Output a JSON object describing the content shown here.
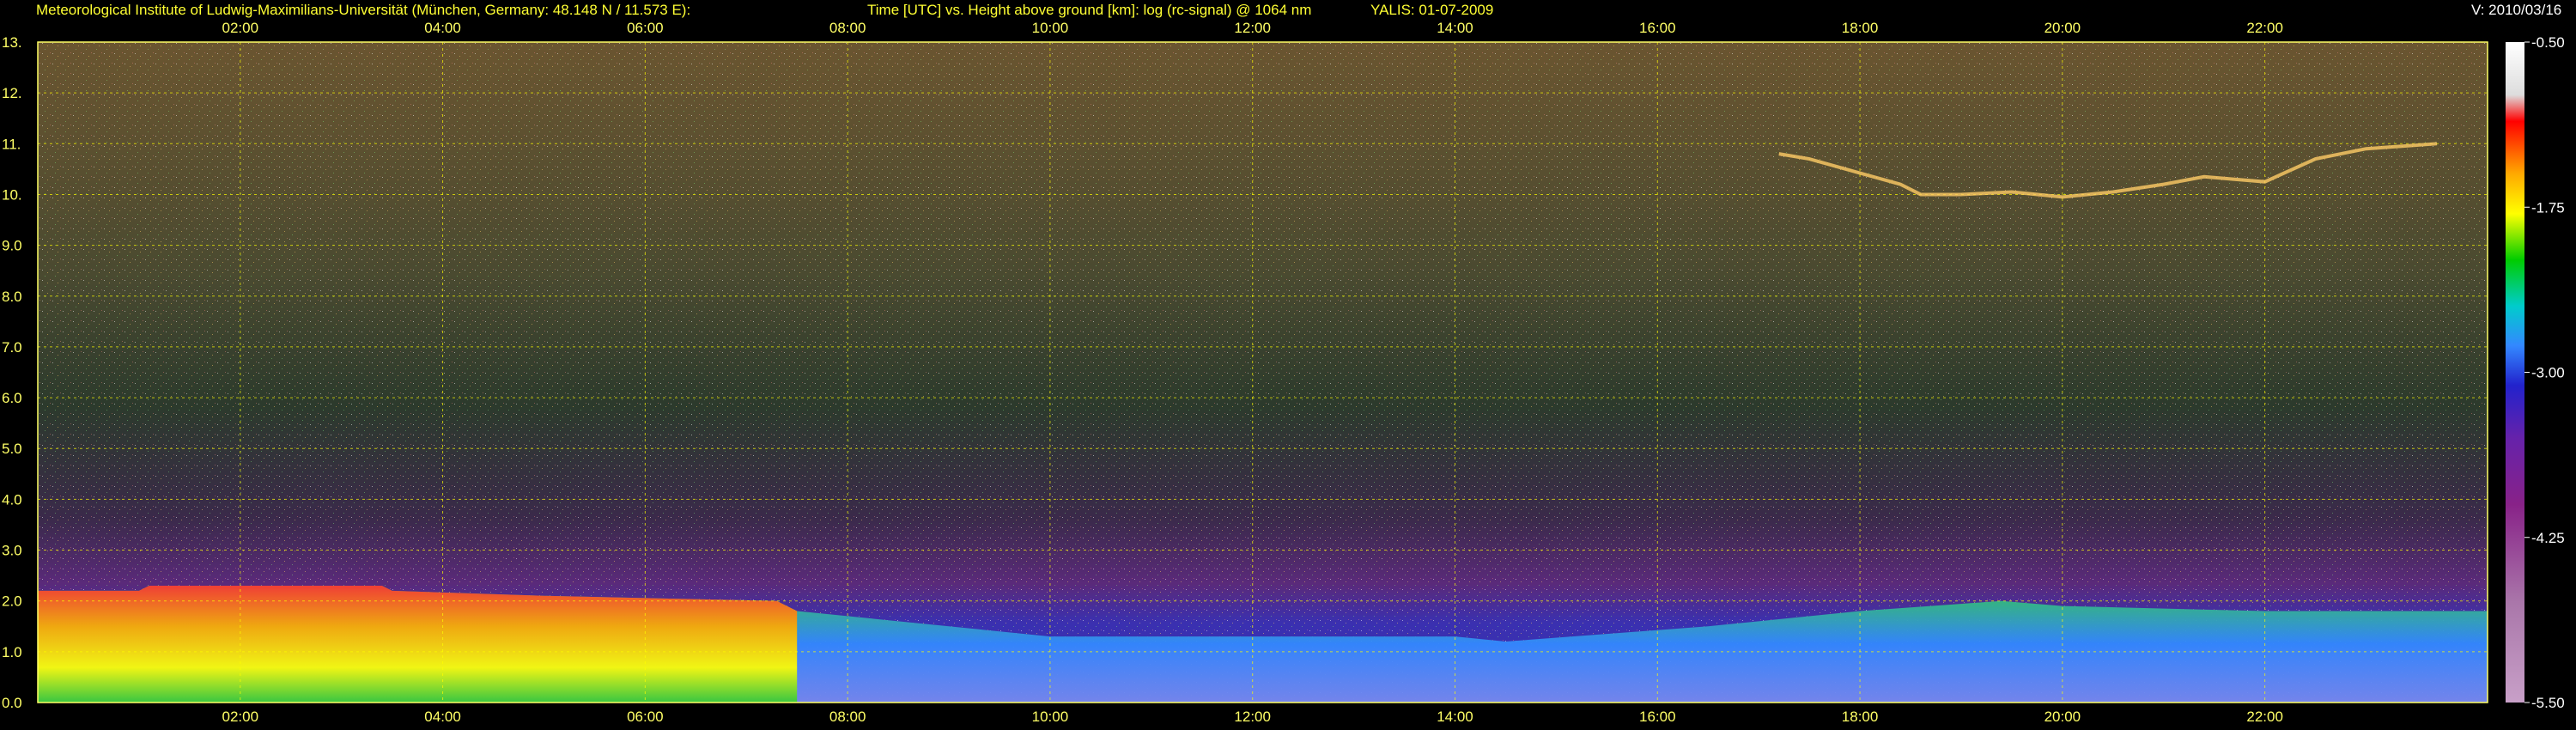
{
  "header": {
    "institute": "Meteorological Institute of Ludwig-Maximilians-Universität (München, Germany: 48.148 N / 11.573 E):",
    "plot_title": "Time [UTC] vs. Height above ground [km]: log (rc-signal) @ 1064 nm",
    "instrument": "YALIS: 01-07-2009",
    "version": "V: 2010/03/16"
  },
  "colors": {
    "header_text": "#ffff33",
    "tick_text": "#ffff66",
    "grid": "#ffff00",
    "background": "#000000"
  },
  "chart_data": {
    "type": "heatmap",
    "title": "Time [UTC] vs. Height above ground [km]: log (rc-signal) @ 1064 nm",
    "xlabel": "",
    "ylabel": "",
    "x_ticks": [
      "02:00",
      "04:00",
      "06:00",
      "08:00",
      "10:00",
      "12:00",
      "14:00",
      "16:00",
      "18:00",
      "20:00",
      "22:00"
    ],
    "x_tick_hours": [
      2,
      4,
      6,
      8,
      10,
      12,
      14,
      16,
      18,
      20,
      22
    ],
    "xlim_hours": [
      0.0,
      24.2
    ],
    "y_ticks": [
      "0.0",
      "1.0",
      "2.0",
      "3.0",
      "4.0",
      "5.0",
      "6.0",
      "7.0",
      "8.0",
      "9.0",
      "10.",
      "11.",
      "12.",
      "13."
    ],
    "y_tick_values": [
      0,
      1,
      2,
      3,
      4,
      5,
      6,
      7,
      8,
      9,
      10,
      11,
      12,
      13
    ],
    "ylim_km": [
      0,
      13
    ],
    "grid": true,
    "colorbar": {
      "ticks": [
        "-0.50",
        "-1.75",
        "-3.00",
        "-4.25",
        "-5.50"
      ],
      "tick_values": [
        -0.5,
        -1.75,
        -3.0,
        -4.25,
        -5.5
      ],
      "range": [
        -5.5,
        -0.5
      ]
    },
    "features": [
      {
        "type": "boundary_layer_top",
        "times_hours": [
          0.0,
          1.0,
          1.1,
          3.4,
          3.5,
          5.0,
          7.3,
          7.5,
          9.0,
          10.0,
          12.0,
          14.0,
          14.5,
          16.5,
          18.0,
          19.4,
          20.0,
          22.0,
          24.2
        ],
        "heights_km": [
          2.2,
          2.2,
          2.3,
          2.3,
          2.2,
          2.1,
          2.0,
          1.8,
          1.5,
          1.3,
          1.3,
          1.3,
          1.2,
          1.5,
          1.8,
          2.0,
          1.9,
          1.8,
          1.8
        ]
      },
      {
        "type": "cirrus",
        "times_hours": [
          17.2,
          17.5,
          18.4,
          18.6,
          19.0,
          19.5,
          20.0,
          20.5,
          21.0,
          21.4,
          21.7,
          22.0,
          22.5,
          23.0,
          23.7
        ],
        "heights_km": [
          10.8,
          10.7,
          10.2,
          10.0,
          10.0,
          10.05,
          9.95,
          10.05,
          10.2,
          10.35,
          10.3,
          10.25,
          10.7,
          10.9,
          11.0
        ]
      }
    ]
  }
}
